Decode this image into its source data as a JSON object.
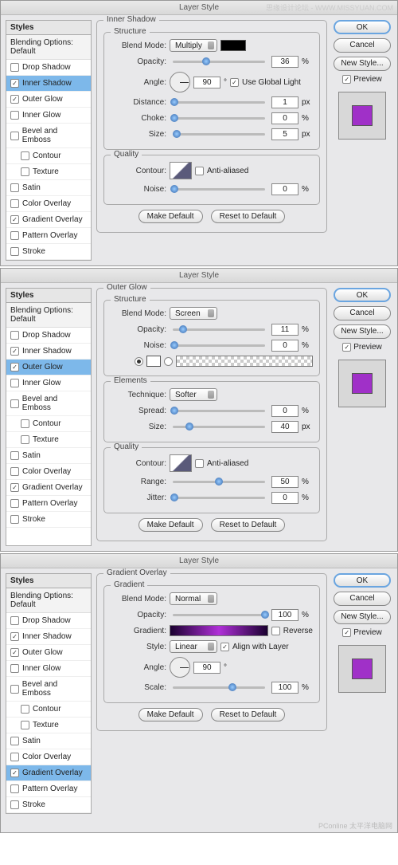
{
  "watermarks": {
    "top": "思缘设计论坛 - WWW.MISSYUAN.COM",
    "bottom": "PConline 太平洋电脑网"
  },
  "common": {
    "title": "Layer Style",
    "styles_header": "Styles",
    "blending_default": "Blending Options: Default",
    "style_names": [
      "Drop Shadow",
      "Inner Shadow",
      "Outer Glow",
      "Inner Glow",
      "Bevel and Emboss",
      "Contour",
      "Texture",
      "Satin",
      "Color Overlay",
      "Gradient Overlay",
      "Pattern Overlay",
      "Stroke"
    ],
    "btn_ok": "OK",
    "btn_cancel": "Cancel",
    "btn_new_style": "New Style...",
    "preview_label": "Preview",
    "make_default": "Make Default",
    "reset_default": "Reset to Default",
    "preview_color": "#a030c8"
  },
  "dlg1": {
    "selected": "Inner Shadow",
    "checked": {
      "Inner Shadow": true,
      "Outer Glow": true,
      "Gradient Overlay": true
    },
    "section": "Inner Shadow",
    "structure": "Structure",
    "quality": "Quality",
    "blend_mode_lbl": "Blend Mode:",
    "blend_mode": "Multiply",
    "blend_color": "#000000",
    "opacity_lbl": "Opacity:",
    "opacity": "36",
    "pct": "%",
    "angle_lbl": "Angle:",
    "angle": "90",
    "deg": "°",
    "ugl": "Use Global Light",
    "distance_lbl": "Distance:",
    "distance": "1",
    "px": "px",
    "choke_lbl": "Choke:",
    "choke": "0",
    "size_lbl": "Size:",
    "size": "5",
    "contour_lbl": "Contour:",
    "aa": "Anti-aliased",
    "noise_lbl": "Noise:",
    "noise": "0"
  },
  "dlg2": {
    "selected": "Outer Glow",
    "checked": {
      "Inner Shadow": true,
      "Outer Glow": true,
      "Gradient Overlay": true
    },
    "section": "Outer Glow",
    "structure": "Structure",
    "elements": "Elements",
    "quality": "Quality",
    "blend_mode_lbl": "Blend Mode:",
    "blend_mode": "Screen",
    "opacity_lbl": "Opacity:",
    "opacity": "11",
    "pct": "%",
    "noise_lbl": "Noise:",
    "noise": "0",
    "solid_color": "#fff",
    "technique_lbl": "Technique:",
    "technique": "Softer",
    "spread_lbl": "Spread:",
    "spread": "0",
    "size_lbl": "Size:",
    "size": "40",
    "px": "px",
    "contour_lbl": "Contour:",
    "aa": "Anti-aliased",
    "range_lbl": "Range:",
    "range": "50",
    "jitter_lbl": "Jitter:",
    "jitter": "0"
  },
  "dlg3": {
    "selected": "Gradient Overlay",
    "checked": {
      "Inner Shadow": true,
      "Outer Glow": true,
      "Gradient Overlay": true
    },
    "section": "Gradient Overlay",
    "gradient_grp": "Gradient",
    "blend_mode_lbl": "Blend Mode:",
    "blend_mode": "Normal",
    "opacity_lbl": "Opacity:",
    "opacity": "100",
    "pct": "%",
    "gradient_lbl": "Gradient:",
    "reverse": "Reverse",
    "gradient_stops": [
      "#1a0030",
      "#b030d8",
      "#1a0030"
    ],
    "style_lbl": "Style:",
    "style": "Linear",
    "align": "Align with Layer",
    "angle_lbl": "Angle:",
    "angle": "90",
    "deg": "°",
    "scale_lbl": "Scale:",
    "scale": "100"
  }
}
